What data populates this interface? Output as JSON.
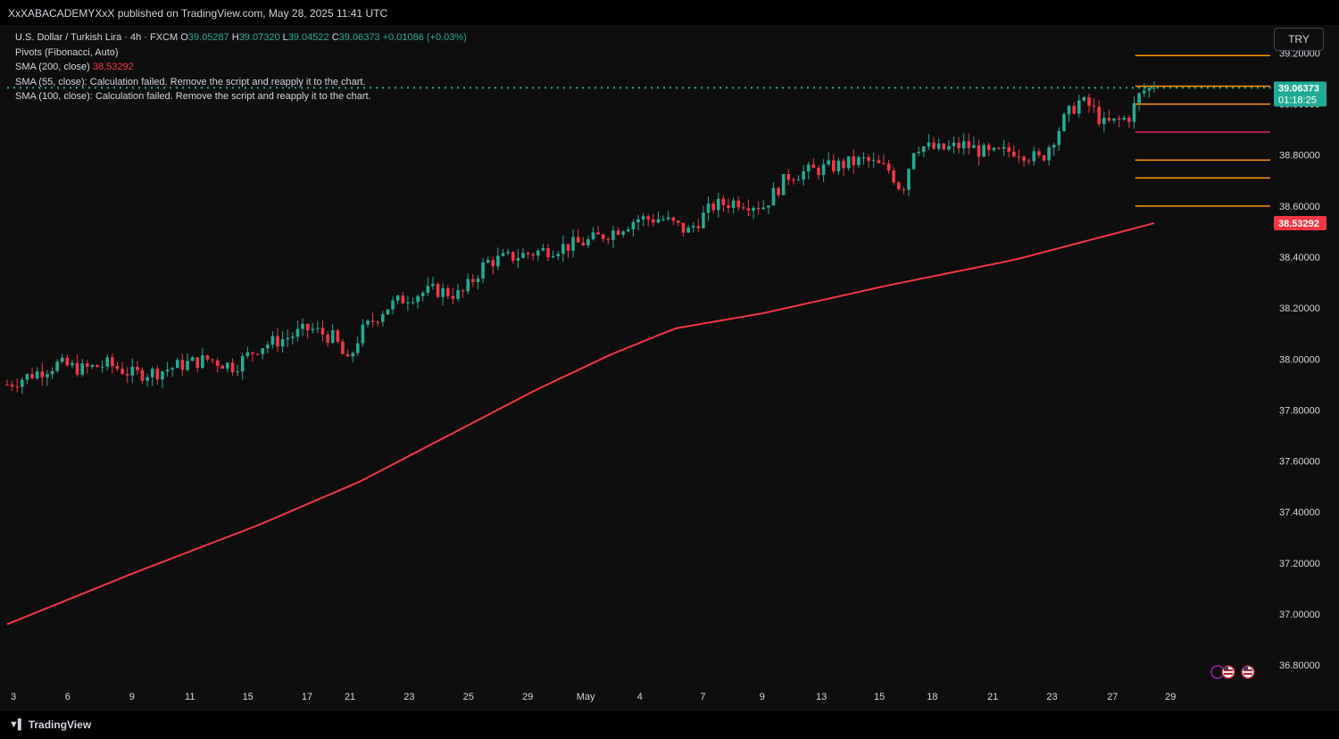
{
  "publisher_line": "XxXABACADEMYXxX published on TradingView.com, May 28, 2025 11:41 UTC",
  "legend": {
    "symbol": "U.S. Dollar / Turkish Lira · 4h · FXCM",
    "open_label": "O",
    "open": "39.05287",
    "high_label": "H",
    "high": "39.07320",
    "low_label": "L",
    "low": "39.04522",
    "close_label": "C",
    "close": "39.06373",
    "change": "+0.01086 (+0.03%)",
    "pivots": "Pivots (Fibonacci, Auto)",
    "sma200": "SMA (200, close)",
    "sma200_value": "38.53292",
    "sma55": "SMA (55, close): Calculation failed. Remove the script and reapply it to the chart.",
    "sma100": "SMA (100, close): Calculation failed. Remove the script and reapply it to the chart."
  },
  "currency_button": "TRY",
  "brand": "TradingView",
  "colors": {
    "up": "#22ab94",
    "down": "#f23645",
    "sma": "#f23645",
    "pivot_orange": "#ff9800",
    "pivot_pink": "#e91e63",
    "price_line": "#22ab94",
    "background": "#0e0e0e",
    "axis_text": "#d1d4dc"
  },
  "chart_data": {
    "type": "candlestick",
    "y_ticks": [
      "39.20000",
      "39.00000",
      "38.80000",
      "38.60000",
      "38.40000",
      "38.20000",
      "38.00000",
      "37.80000",
      "37.60000",
      "37.40000",
      "37.20000",
      "37.00000",
      "36.80000"
    ],
    "y_tick_values": [
      39.2,
      39.0,
      38.8,
      38.6,
      38.4,
      38.2,
      38.0,
      37.8,
      37.6,
      37.4,
      37.2,
      37.0,
      36.8
    ],
    "ylim": [
      36.75,
      39.3
    ],
    "x_ticks": [
      "3",
      "6",
      "9",
      "11",
      "15",
      "17",
      "21",
      "23",
      "25",
      "29",
      "May",
      "4",
      "7",
      "9",
      "13",
      "15",
      "18",
      "21",
      "23",
      "27",
      "29"
    ],
    "x_tick_frac": [
      0.005,
      0.048,
      0.099,
      0.145,
      0.191,
      0.238,
      0.272,
      0.319,
      0.366,
      0.413,
      0.459,
      0.502,
      0.552,
      0.599,
      0.646,
      0.692,
      0.734,
      0.782,
      0.829,
      0.877,
      0.923
    ],
    "last_price": 39.06373,
    "last_price_label": "39.06373",
    "countdown": "01:18:25",
    "sma_label": "38.53292",
    "sma_value": 38.53292,
    "pivot_levels": [
      {
        "value": 39.19,
        "color": "orange"
      },
      {
        "value": 39.07,
        "color": "orange"
      },
      {
        "value": 39.0,
        "color": "orange"
      },
      {
        "value": 38.89,
        "color": "pink"
      },
      {
        "value": 38.78,
        "color": "orange"
      },
      {
        "value": 38.71,
        "color": "orange"
      },
      {
        "value": 38.6,
        "color": "orange"
      }
    ],
    "price_path": [
      [
        0,
        37.9
      ],
      [
        0.02,
        37.94
      ],
      [
        0.04,
        37.98
      ],
      [
        0.06,
        37.96
      ],
      [
        0.08,
        37.98
      ],
      [
        0.1,
        37.94
      ],
      [
        0.12,
        37.95
      ],
      [
        0.14,
        37.98
      ],
      [
        0.16,
        38.0
      ],
      [
        0.18,
        37.97
      ],
      [
        0.2,
        38.05
      ],
      [
        0.22,
        38.08
      ],
      [
        0.24,
        38.12
      ],
      [
        0.26,
        38.08
      ],
      [
        0.27,
        37.98
      ],
      [
        0.28,
        38.1
      ],
      [
        0.3,
        38.2
      ],
      [
        0.32,
        38.25
      ],
      [
        0.34,
        38.27
      ],
      [
        0.36,
        38.25
      ],
      [
        0.38,
        38.38
      ],
      [
        0.4,
        38.4
      ],
      [
        0.42,
        38.42
      ],
      [
        0.44,
        38.44
      ],
      [
        0.46,
        38.46
      ],
      [
        0.48,
        38.5
      ],
      [
        0.5,
        38.55
      ],
      [
        0.52,
        38.55
      ],
      [
        0.54,
        38.5
      ],
      [
        0.56,
        38.6
      ],
      [
        0.58,
        38.62
      ],
      [
        0.6,
        38.6
      ],
      [
        0.62,
        38.72
      ],
      [
        0.64,
        38.74
      ],
      [
        0.66,
        38.76
      ],
      [
        0.68,
        38.78
      ],
      [
        0.7,
        38.74
      ],
      [
        0.71,
        38.66
      ],
      [
        0.72,
        38.84
      ],
      [
        0.74,
        38.82
      ],
      [
        0.76,
        38.84
      ],
      [
        0.78,
        38.8
      ],
      [
        0.8,
        38.82
      ],
      [
        0.82,
        38.78
      ],
      [
        0.84,
        38.95
      ],
      [
        0.85,
        39.01
      ],
      [
        0.86,
        38.99
      ],
      [
        0.87,
        38.92
      ],
      [
        0.88,
        38.93
      ],
      [
        0.89,
        38.95
      ],
      [
        0.9,
        39.05
      ],
      [
        0.91,
        39.06373
      ]
    ],
    "sma_path": [
      [
        0,
        36.96
      ],
      [
        0.1,
        37.16
      ],
      [
        0.2,
        37.35
      ],
      [
        0.28,
        37.52
      ],
      [
        0.35,
        37.7
      ],
      [
        0.42,
        37.88
      ],
      [
        0.48,
        38.02
      ],
      [
        0.53,
        38.12
      ],
      [
        0.6,
        38.18
      ],
      [
        0.7,
        38.29
      ],
      [
        0.8,
        38.39
      ],
      [
        0.91,
        38.53292
      ]
    ]
  }
}
